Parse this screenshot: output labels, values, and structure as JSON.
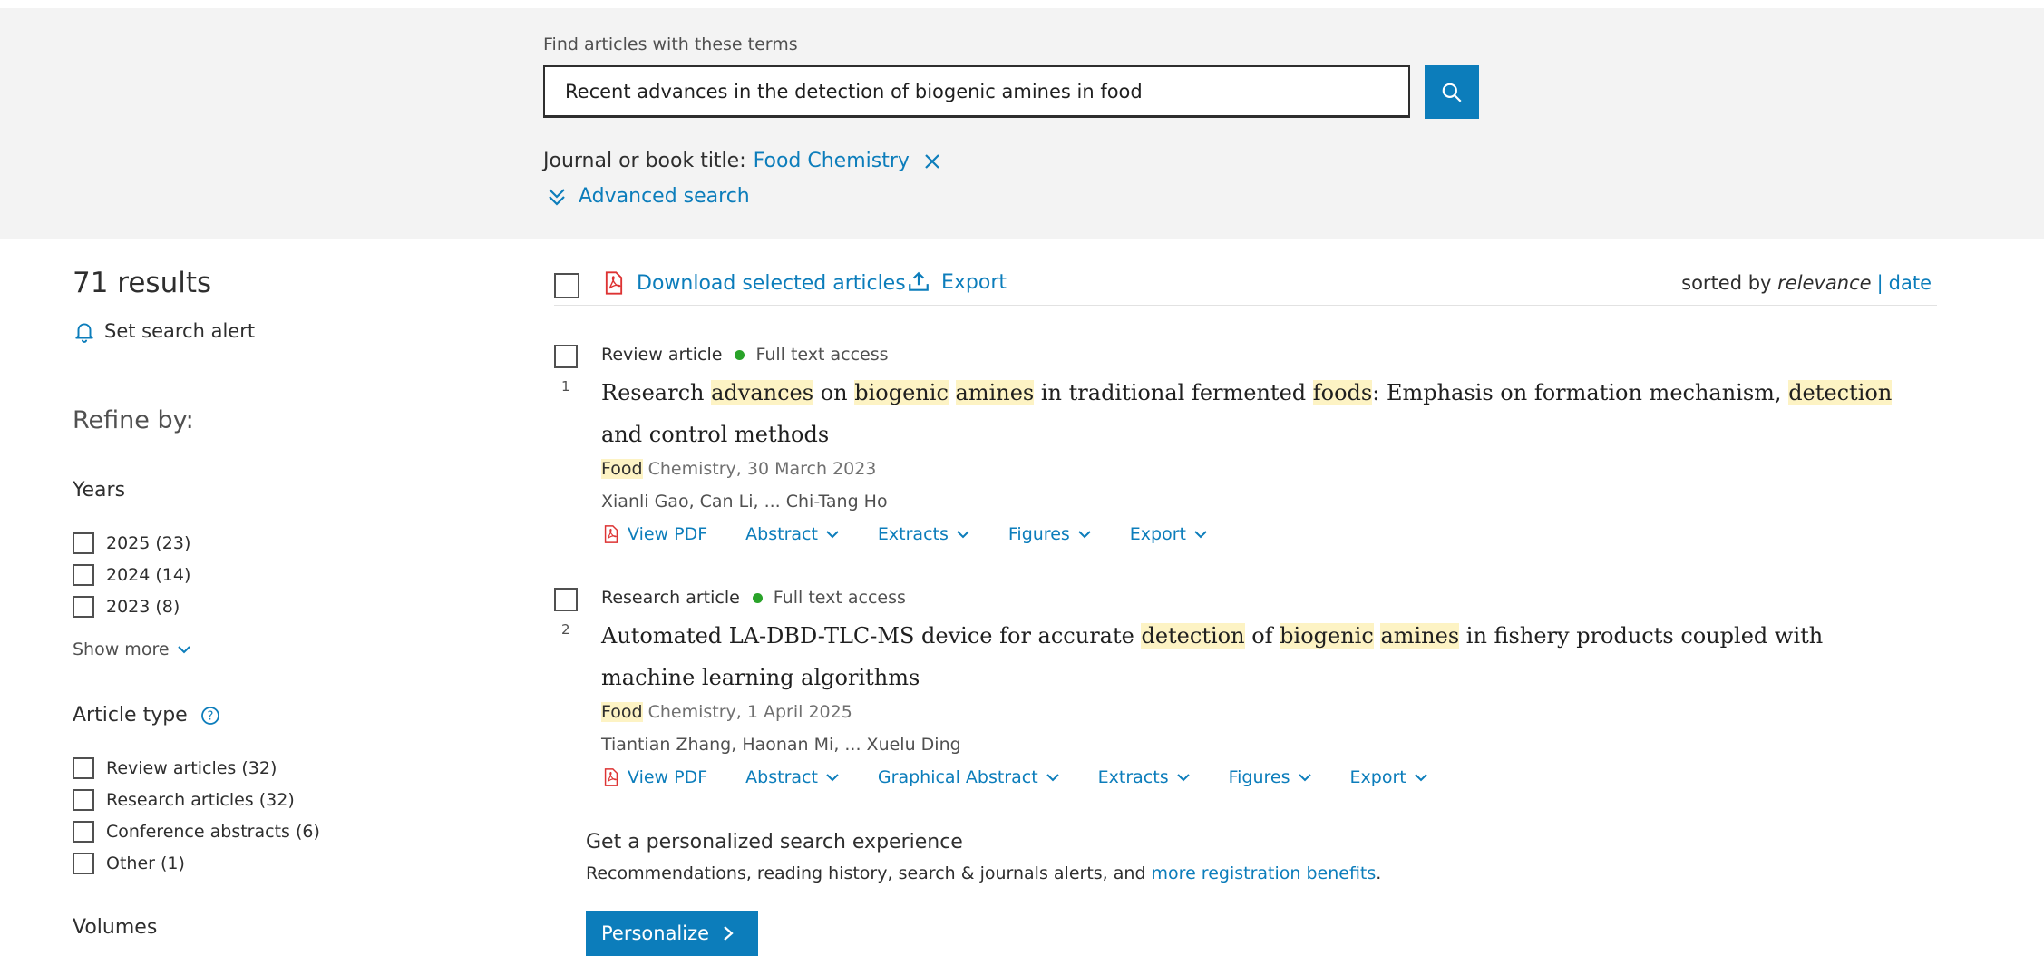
{
  "search": {
    "find_label": "Find articles with these terms",
    "query": "Recent advances in the detection of biogenic amines in food",
    "journal_filter_label": "Journal or book title:",
    "journal_filter_value": "Food Chemistry",
    "advanced_search": "Advanced search"
  },
  "sidebar": {
    "results_count": "71 results",
    "set_alert": "Set search alert",
    "refine_by": "Refine by:",
    "years": {
      "title": "Years",
      "items": [
        "2025 (23)",
        "2024 (14)",
        "2023 (8)"
      ],
      "show_more": "Show more"
    },
    "article_type": {
      "title": "Article type",
      "items": [
        "Review articles (32)",
        "Research articles (32)",
        "Conference abstracts (6)",
        "Other (1)"
      ]
    },
    "volumes_title": "Volumes"
  },
  "toolbar": {
    "download_selected": "Download selected articles",
    "export": "Export",
    "sorted_by": "sorted by",
    "sort_relevance": "relevance",
    "sort_separator": "|",
    "sort_date": "date"
  },
  "results": [
    {
      "number": "1",
      "type": "Review article",
      "access": "Full text access",
      "source_highlight": "Food",
      "source_rest": " Chemistry, 30 March 2023",
      "authors": "Xianli Gao, Can Li, ... Chi-Tang Ho",
      "actions": [
        "View PDF",
        "Abstract",
        "Extracts",
        "Figures",
        "Export"
      ]
    },
    {
      "number": "2",
      "type": "Research article",
      "access": "Full text access",
      "source_highlight": "Food",
      "source_rest": " Chemistry, 1 April 2025",
      "authors": "Tiantian Zhang, Haonan Mi, ... Xuelu Ding",
      "actions": [
        "View PDF",
        "Abstract",
        "Graphical Abstract",
        "Extracts",
        "Figures",
        "Export"
      ]
    }
  ],
  "title_segments": {
    "r1": [
      "Research ",
      "advances",
      " on ",
      "biogenic",
      " ",
      "amines",
      " in traditional fermented ",
      "foods",
      ": Emphasis on formation mechanism, ",
      "detection",
      " and control methods"
    ],
    "r2": [
      "Automated LA-DBD-TLC-MS device for accurate ",
      "detection",
      " of ",
      "biogenic",
      " ",
      "amines",
      " in fishery products coupled with machine learning algorithms"
    ]
  },
  "personalize": {
    "title": "Get a personalized search experience",
    "text": "Recommendations, reading history, search & journals alerts, and ",
    "link": "more registration benefits",
    "text_end": ".",
    "button": "Personalize"
  },
  "colors": {
    "accent": "#0c7dbb",
    "highlight": "#fdf3c4",
    "access_dot": "#29a329",
    "search_band": "#f3f3f3"
  }
}
